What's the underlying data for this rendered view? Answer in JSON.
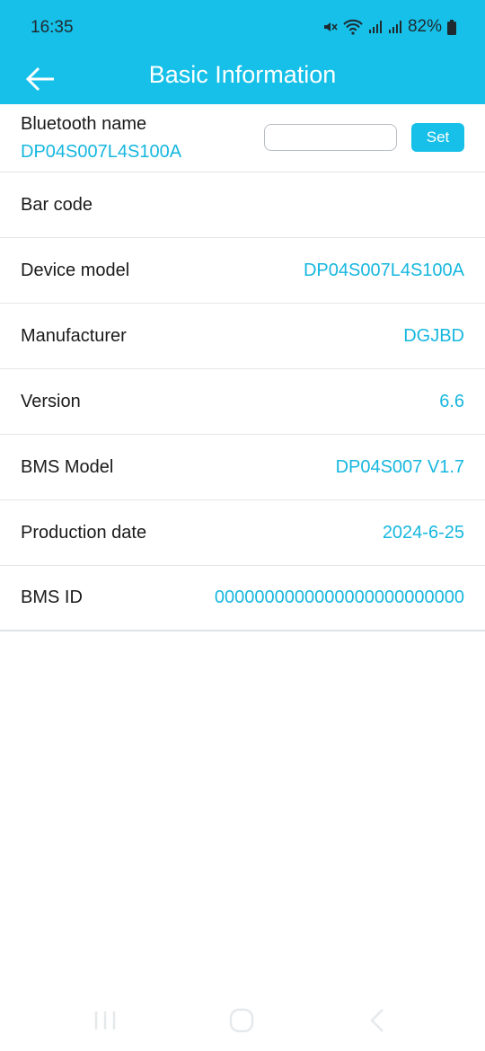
{
  "status_bar": {
    "time": "16:35",
    "battery_percent": "82%",
    "icons": [
      "mute-icon",
      "wifi-icon",
      "signal-icon",
      "signal-icon",
      "battery-icon"
    ]
  },
  "app_bar": {
    "title": "Basic Information",
    "back_icon": "back-arrow-icon",
    "color": "#16c0e8"
  },
  "bluetooth": {
    "label": "Bluetooth name",
    "value": "DP04S007L4S100A",
    "input_value": "",
    "set_label": "Set"
  },
  "info_rows": [
    {
      "label": "Bar code",
      "value": ""
    },
    {
      "label": "Device model",
      "value": "DP04S007L4S100A"
    },
    {
      "label": "Manufacturer",
      "value": "DGJBD"
    },
    {
      "label": "Version",
      "value": "6.6"
    },
    {
      "label": "BMS Model",
      "value": "DP04S007 V1.7"
    },
    {
      "label": "Production date",
      "value": "2024-6-25"
    },
    {
      "label": "BMS ID",
      "value": "0000000000000000000000000"
    }
  ],
  "nav_bar": {
    "icons": [
      "recent-apps-icon",
      "home-icon",
      "back-icon"
    ]
  },
  "colors": {
    "accent": "#16c0e8",
    "value_text": "#16b7df"
  }
}
